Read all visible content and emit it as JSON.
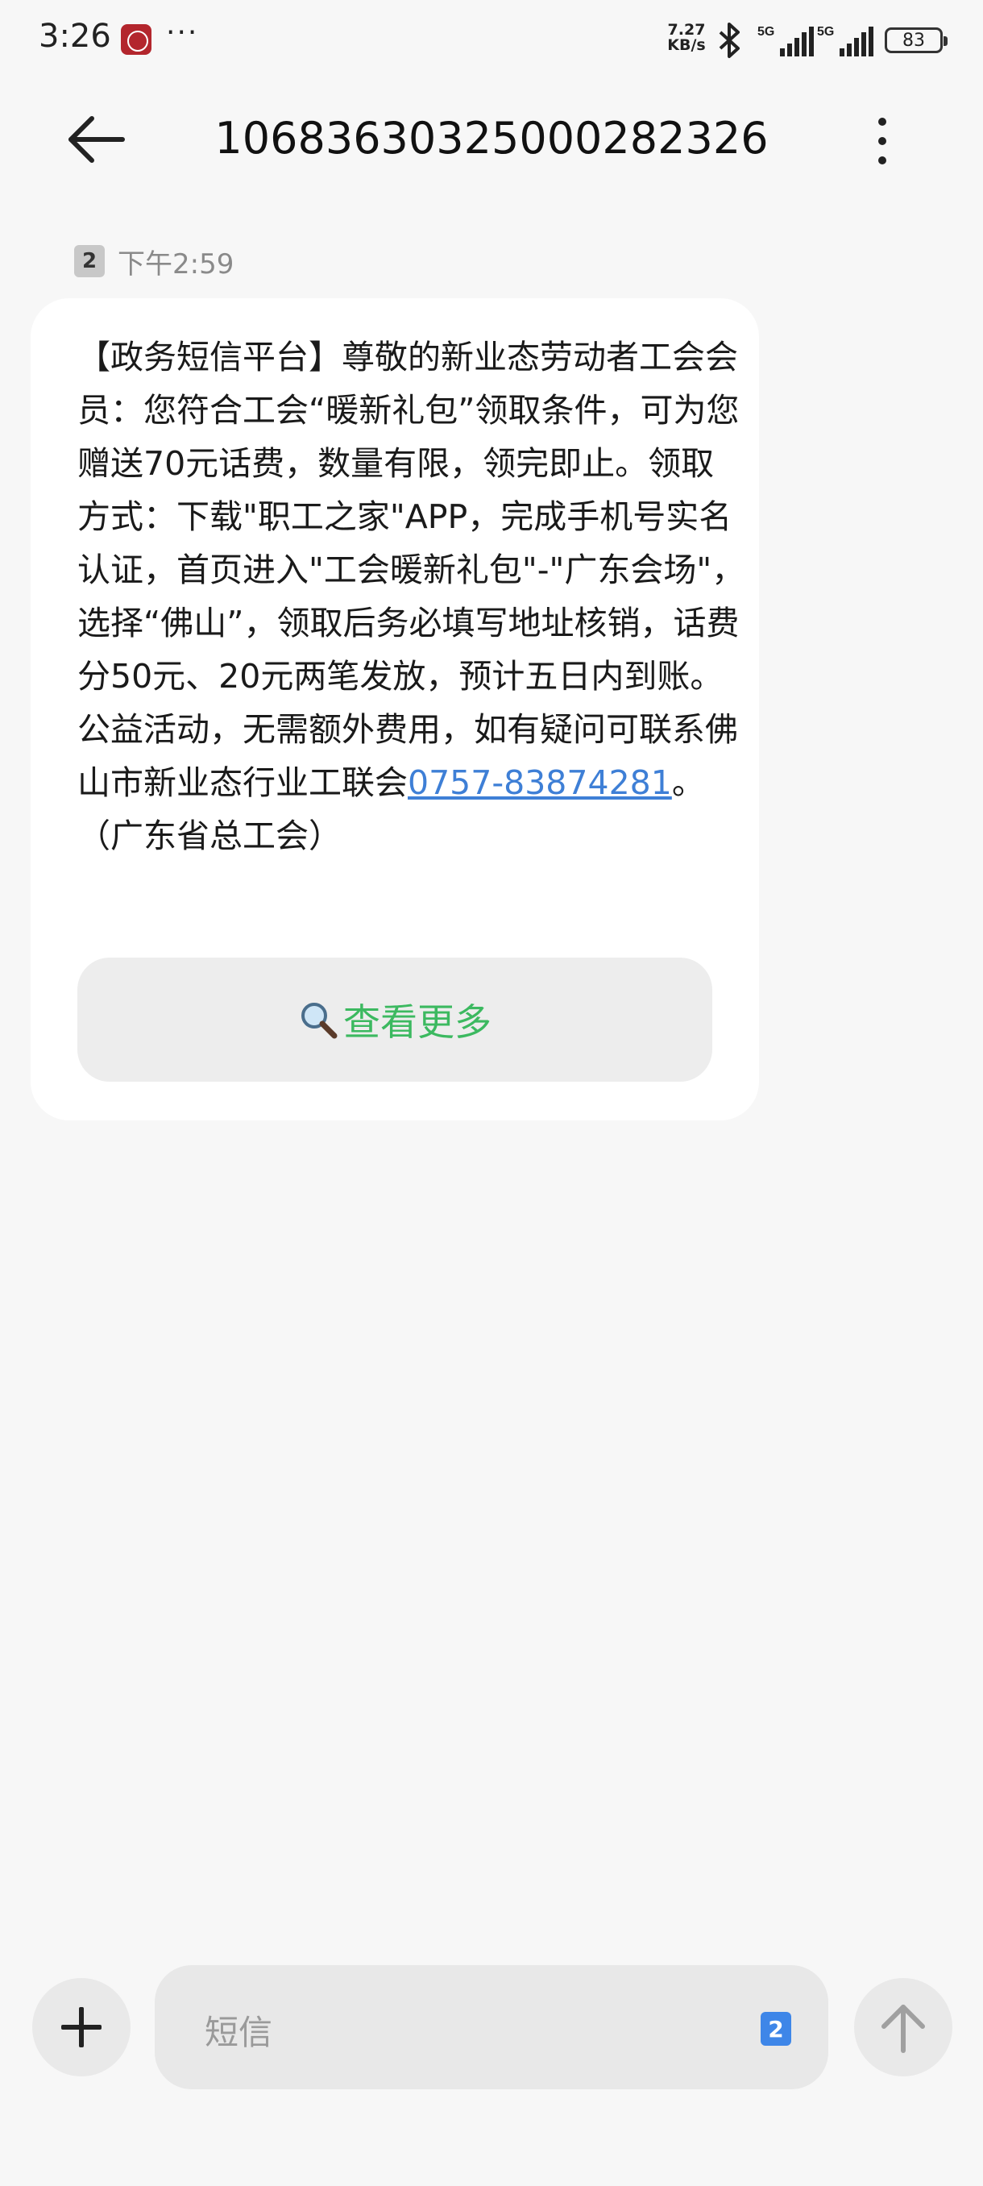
{
  "status_bar": {
    "time": "3:26",
    "more": "···",
    "net_speed_value": "7.27",
    "net_speed_unit": "KB/s",
    "signal1_label": "5G",
    "signal2_label": "5G",
    "battery": "83"
  },
  "header": {
    "contact_number": "10683630325000282326"
  },
  "message": {
    "sim_slot": "2",
    "time": "下午2:59",
    "body_before_link": "【政务短信平台】尊敬的新业态劳动者工会会员：您符合工会“暖新礼包”领取条件，可为您赠送70元话费，数量有限，领完即止。领取方式：下载\"职工之家\"APP，完成手机号实名认证，首页进入\"工会暖新礼包\"-\"广东会场\"，选择“佛山”，领取后务必填写地址核销，话费分50元、20元两笔发放，预计五日内到账。公益活动，无需额外费用，如有疑问可联系佛山市新业态行业工联会",
    "phone_link": "0757-83874281",
    "body_after_link": "。（广东省总工会）",
    "view_more_label": "查看更多"
  },
  "composer": {
    "placeholder": "短信",
    "sim_slot": "2"
  },
  "colors": {
    "background": "#f7f7f7",
    "bubble": "#ffffff",
    "link": "#3e7fd6",
    "view_more_text": "#3cb960",
    "sim_badge_active": "#3e86e8"
  },
  "icons": [
    "back-arrow-icon",
    "more-vertical-icon",
    "bluetooth-icon",
    "signal-icon",
    "battery-icon",
    "search-icon",
    "plus-icon",
    "send-arrow-icon"
  ]
}
